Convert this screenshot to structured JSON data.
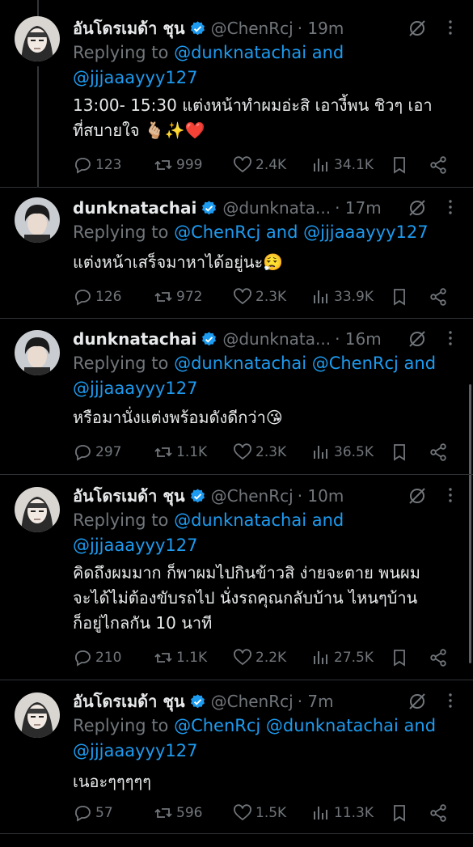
{
  "colors": {
    "accent": "#1d9bf0",
    "muted": "#71767b",
    "text": "#e7e9ea",
    "background": "#000000"
  },
  "tweets": [
    {
      "name": "อันโดรเมด้า ชุน",
      "handle": "@ChenRcj",
      "time": "· 19m",
      "reply_prefix": "Replying to ",
      "reply_line1": "@dunknatachai and",
      "reply_line2": "@jjjaaayyy127",
      "text_line1": "13:00- 15:30 แต่งหน้าทำผมอ่ะสิ  เอางี้พน ชิวๆ เอา",
      "text_line2": "ที่สบายใจ  🫰🏼✨❤️",
      "reply_count": "123",
      "repost_count": "999",
      "like_count": "2.4K",
      "view_count": "34.1K"
    },
    {
      "name": "dunknatachai",
      "handle": "@dunknata...",
      "time": "· 17m",
      "reply_prefix": "Replying to ",
      "reply_line1": "@ChenRcj and @jjjaaayyy127",
      "text_line1": "แต่งหน้าเสร็จมาหาได้อยู่นะ😮‍💨",
      "reply_count": "126",
      "repost_count": "972",
      "like_count": "2.3K",
      "view_count": "33.9K"
    },
    {
      "name": "dunknatachai",
      "handle": "@dunknata...",
      "time": "· 16m",
      "reply_prefix": "Replying to ",
      "reply_line1": "@dunknatachai @ChenRcj and",
      "reply_line2": "@jjjaaayyy127",
      "text_line1": "หรือมานั่งแต่งพร้อมดังดีกว่า😘",
      "reply_count": "297",
      "repost_count": "1.1K",
      "like_count": "2.3K",
      "view_count": "36.5K"
    },
    {
      "name": "อันโดรเมด้า ชุน",
      "handle": "@ChenRcj",
      "time": "· 10m",
      "reply_prefix": "Replying to ",
      "reply_line1": "@dunknatachai and",
      "reply_line2": "@jjjaaayyy127",
      "text_line1": "คิดถึงผมมาก ก็พาผมไปกินข้าวสิ ง่ายจะตาย พนผม",
      "text_line2": "จะได้ไม่ต้องขับรถไป นั่งรถคุณกลับบ้าน ไหนๆบ้าน",
      "text_line3": "ก็อยู่ไกลกัน 10 นาที",
      "reply_count": "210",
      "repost_count": "1.1K",
      "like_count": "2.2K",
      "view_count": "27.5K"
    },
    {
      "name": "อันโดรเมด้า ชุน",
      "handle": "@ChenRcj",
      "time": "· 7m",
      "reply_prefix": "Replying to ",
      "reply_line1": "@ChenRcj @dunknatachai and",
      "reply_line2": "@jjjaaayyy127",
      "text_line1": "เนอะๆๆๆๆๆ",
      "reply_count": "57",
      "repost_count": "596",
      "like_count": "1.5K",
      "view_count": "11.3K"
    }
  ]
}
